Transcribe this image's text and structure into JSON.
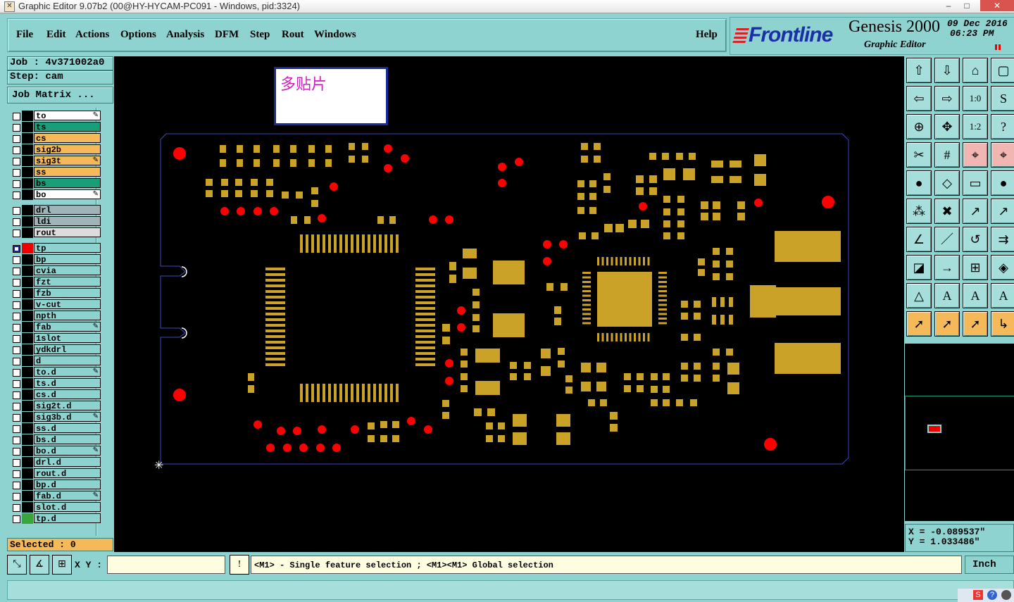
{
  "window": {
    "title": "Graphic Editor 9.07b2 (00@HY-HYCAM-PC091 - Windows, pid:3324)",
    "min": "–",
    "max": "□",
    "close": "✕"
  },
  "menu": {
    "items": [
      "File",
      "Edit",
      "Actions",
      "Options",
      "Analysis",
      "DFM",
      "Step",
      "Rout",
      "Windows"
    ],
    "help": "Help"
  },
  "logo": {
    "brand": "Frontline",
    "product": "Genesis 2000",
    "subtitle": "Graphic Editor",
    "date": "09 Dec 2016",
    "time": "06:23 PM"
  },
  "job": {
    "job_line": "Job : 4v371002a0",
    "step_line": "Step: cam",
    "matrix_button": "Job Matrix ..."
  },
  "layers": [
    {
      "name": "to",
      "color": "#ffffff",
      "pen": true
    },
    {
      "name": "ts",
      "color": "#1a9e7a",
      "pen": false
    },
    {
      "name": "cs",
      "color": "#f6b95a",
      "pen": false
    },
    {
      "name": "sig2b",
      "color": "#f6b95a",
      "pen": false
    },
    {
      "name": "sig3t",
      "color": "#f6b95a",
      "pen": true
    },
    {
      "name": "ss",
      "color": "#f6b95a",
      "pen": false
    },
    {
      "name": "bs",
      "color": "#1a9e7a",
      "pen": false
    },
    {
      "name": "bo",
      "color": "#ffffff",
      "pen": true
    },
    {
      "name": "drl",
      "color": "#9fb3b8",
      "pen": false,
      "gap": true
    },
    {
      "name": "ldi",
      "color": "#9fb3b8",
      "pen": false
    },
    {
      "name": "rout",
      "color": "#dcdcdc",
      "pen": false
    },
    {
      "name": "tp",
      "color": "#8fd3d0",
      "pen": false,
      "gap": true,
      "active": true
    },
    {
      "name": "bp",
      "color": "#8fd3d0",
      "pen": false
    },
    {
      "name": "cvia",
      "color": "#8fd3d0",
      "pen": false
    },
    {
      "name": "fzt",
      "color": "#8fd3d0",
      "pen": false
    },
    {
      "name": "fzb",
      "color": "#8fd3d0",
      "pen": false
    },
    {
      "name": "v-cut",
      "color": "#8fd3d0",
      "pen": false
    },
    {
      "name": "npth",
      "color": "#8fd3d0",
      "pen": false
    },
    {
      "name": "fab",
      "color": "#8fd3d0",
      "pen": true
    },
    {
      "name": "1slot",
      "color": "#8fd3d0",
      "pen": false
    },
    {
      "name": "ydkdrl",
      "color": "#8fd3d0",
      "pen": false
    },
    {
      "name": "d",
      "color": "#8fd3d0",
      "pen": false
    },
    {
      "name": "to.d",
      "color": "#8fd3d0",
      "pen": true
    },
    {
      "name": "ts.d",
      "color": "#8fd3d0",
      "pen": false
    },
    {
      "name": "cs.d",
      "color": "#8fd3d0",
      "pen": false
    },
    {
      "name": "sig2t.d",
      "color": "#8fd3d0",
      "pen": false
    },
    {
      "name": "sig3b.d",
      "color": "#8fd3d0",
      "pen": true
    },
    {
      "name": "ss.d",
      "color": "#8fd3d0",
      "pen": false
    },
    {
      "name": "bs.d",
      "color": "#8fd3d0",
      "pen": false
    },
    {
      "name": "bo.d",
      "color": "#8fd3d0",
      "pen": true
    },
    {
      "name": "drl.d",
      "color": "#8fd3d0",
      "pen": false
    },
    {
      "name": "rout.d",
      "color": "#8fd3d0",
      "pen": false
    },
    {
      "name": "bp.d",
      "color": "#8fd3d0",
      "pen": false
    },
    {
      "name": "fab.d",
      "color": "#8fd3d0",
      "pen": true
    },
    {
      "name": "slot.d",
      "color": "#8fd3d0",
      "pen": false
    },
    {
      "name": "tp.d",
      "color": "#8fd3d0",
      "pen": false,
      "green": true
    }
  ],
  "pen_glyph": "✎",
  "annotation": {
    "text": "多贴片"
  },
  "selected": "Selected : 0",
  "coords": {
    "x": "X = -0.089537\"",
    "y": "Y = 1.033486\""
  },
  "cmd": {
    "xy_label": "X Y :",
    "xy_value": "",
    "message": "<M1> - Single feature selection ; <M1><M1> Global selection",
    "unit": "Inch",
    "alert": "!"
  },
  "colors": {
    "pad": "#c9a227",
    "drill": "#ff0000",
    "outline": "#3a4ab8",
    "canvas": "#000000"
  },
  "toolbar_icons": [
    "layer-up-icon",
    "layer-down-icon",
    "home-icon",
    "window-icon",
    "zoom-in-icon",
    "zoom-out-icon",
    "one-to-one-icon",
    "redraw-icon",
    "fit-icon",
    "center-icon",
    "scale-icon",
    "help-icon",
    "measure-icon",
    "grid-icon",
    "snap-icon",
    "snap2-icon",
    "pad-icon",
    "shape-icon",
    "ruler-icon",
    "circle-icon",
    "connect-icon",
    "cross-icon",
    "point-icon",
    "point2-icon",
    "line-icon",
    "line2-icon",
    "arc-icon",
    "split-icon",
    "box-icon",
    "move-icon",
    "copy-icon",
    "group-icon",
    "triangle-icon",
    "polygon-icon",
    "polygon2-icon",
    "polygon3-icon",
    "select-icon",
    "select2-icon",
    "select3-icon",
    "select4-icon"
  ],
  "toolbar_glyphs": [
    "⇧",
    "⇩",
    "⌂",
    "▢",
    "⇦",
    "⇨",
    "1:0",
    "S",
    "⊕",
    "✥",
    "1:2",
    "?",
    "✂",
    "#",
    "⌖",
    "⌖",
    "●",
    "◇",
    "▭",
    "●",
    "⁂",
    "✖",
    "↗",
    "↗",
    "∠",
    "／",
    "↺",
    "⇉",
    "◪",
    "→",
    "⊞",
    "◈",
    "△",
    "A",
    "A",
    "A",
    "➚",
    "➚",
    "➚",
    "↳"
  ]
}
